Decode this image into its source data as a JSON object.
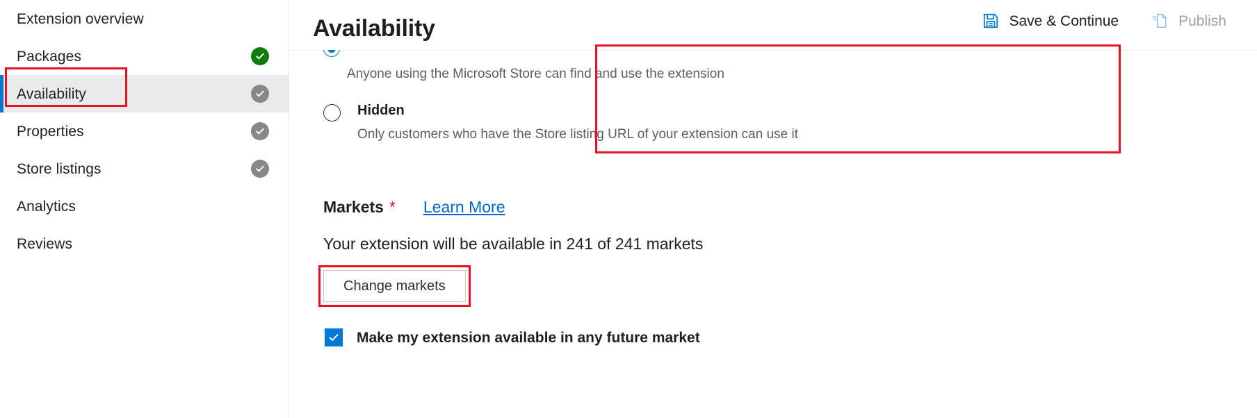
{
  "sidebar": {
    "items": [
      {
        "label": "Extension overview",
        "status": "none",
        "selected": false
      },
      {
        "label": "Packages",
        "status": "complete",
        "selected": false
      },
      {
        "label": "Availability",
        "status": "pending",
        "selected": true
      },
      {
        "label": "Properties",
        "status": "pending",
        "selected": false
      },
      {
        "label": "Store listings",
        "status": "pending",
        "selected": false
      },
      {
        "label": "Analytics",
        "status": "none",
        "selected": false
      },
      {
        "label": "Reviews",
        "status": "none",
        "selected": false
      }
    ]
  },
  "header": {
    "title": "Availability",
    "save_label": "Save & Continue",
    "save_icon": "save-floppy-icon",
    "publish_label": "Publish",
    "publish_icon": "publish-document-icon",
    "publish_disabled": true
  },
  "visibility": {
    "public_description": "Anyone using the Microsoft Store can find and use the extension",
    "hidden_title": "Hidden",
    "hidden_description": "Only customers who have the Store listing URL of your extension can use it",
    "selected": "public"
  },
  "markets": {
    "label": "Markets",
    "required_marker": "*",
    "learn_more_label": "Learn More",
    "summary": "Your extension will be available in 241 of 241 markets",
    "available_count": 241,
    "total_count": 241,
    "change_button_label": "Change markets",
    "future_market_label": "Make my extension available in any future market",
    "future_market_checked": true
  },
  "colors": {
    "accent_blue": "#0078d4",
    "link_blue": "#0066cc",
    "complete_green": "#107c10",
    "pending_gray": "#8a8886",
    "annotation_red": "#e81123",
    "selected_row_bg": "#ebeaea"
  }
}
